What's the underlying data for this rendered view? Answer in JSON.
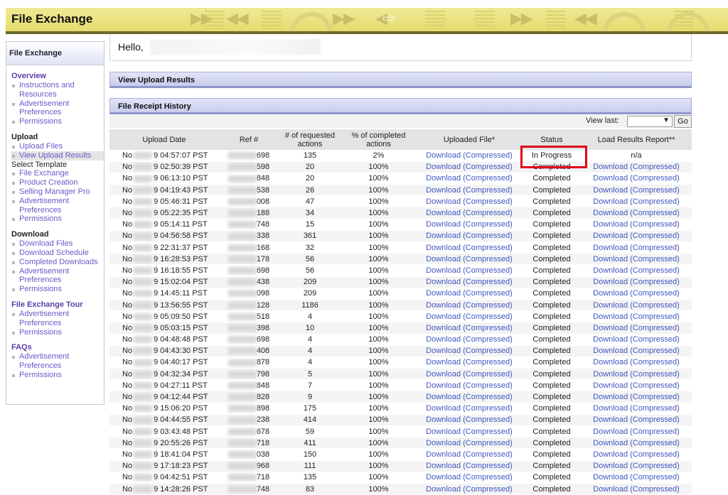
{
  "app": {
    "title": "File Exchange"
  },
  "greeting": "Hello,",
  "sidebar": {
    "title": "File Exchange",
    "sections": [
      {
        "heading": "Overview",
        "heading_is_link": true,
        "items": [
          {
            "label": "Instructions and",
            "label2": "Resources"
          },
          {
            "label": "Advertisement",
            "label2": "Preferences"
          },
          {
            "label": "Permissions"
          }
        ]
      },
      {
        "heading": "Upload",
        "heading_is_link": false,
        "items": [
          {
            "label": "Upload Files"
          },
          {
            "label": "View Upload Results",
            "active": true
          },
          {
            "plain": "Select Template"
          },
          {
            "label": "File Exchange"
          },
          {
            "label": "Product Creation"
          },
          {
            "label": "Selling Manager Pro"
          },
          {
            "label": "Advertisement",
            "label2": "Preferences"
          },
          {
            "label": "Permissions"
          }
        ]
      },
      {
        "heading": "Download",
        "heading_is_link": false,
        "items": [
          {
            "label": "Download Files"
          },
          {
            "label": "Download Schedule"
          },
          {
            "label": "Completed Downloads"
          },
          {
            "label": "Advertisement",
            "label2": "Preferences"
          },
          {
            "label": "Permissions"
          }
        ]
      },
      {
        "heading": "File Exchange Tour",
        "heading_is_link": true,
        "items": [
          {
            "label": "Advertisement",
            "label2": "Preferences"
          },
          {
            "label": "Permissions"
          }
        ]
      },
      {
        "heading": "FAQs",
        "heading_is_link": true,
        "items": [
          {
            "label": "Advertisement",
            "label2": "Preferences"
          },
          {
            "label": "Permissions"
          }
        ]
      }
    ]
  },
  "upload_results": {
    "title": "View Upload Results"
  },
  "history": {
    "title": "File Receipt History",
    "view_last_label": "View last:",
    "view_last_value": "",
    "go_label": "Go",
    "columns": [
      "Upload Date",
      "Ref #",
      "# of requested actions",
      "% of completed actions",
      "Uploaded File*",
      "Status",
      "Load Results Report**"
    ],
    "download_label": "Download",
    "compressed_label": "(Compressed)",
    "rows": [
      {
        "date": "9 04:57:07 PST",
        "ref": "698",
        "requested": "135",
        "completed": "2%",
        "status": "In Progress",
        "report": "n/a"
      },
      {
        "date": "9 02:50:39 PST",
        "ref": "598",
        "requested": "20",
        "completed": "100%",
        "status": "Completed"
      },
      {
        "date": "9 06:13:10 PST",
        "ref": "848",
        "requested": "20",
        "completed": "100%",
        "status": "Completed"
      },
      {
        "date": "9 04:19:43 PST",
        "ref": "538",
        "requested": "26",
        "completed": "100%",
        "status": "Completed"
      },
      {
        "date": "9 05:46:31 PST",
        "ref": "008",
        "requested": "47",
        "completed": "100%",
        "status": "Completed"
      },
      {
        "date": "9 05:22:35 PST",
        "ref": "188",
        "requested": "34",
        "completed": "100%",
        "status": "Completed"
      },
      {
        "date": "9 05:14:11 PST",
        "ref": "748",
        "requested": "15",
        "completed": "100%",
        "status": "Completed"
      },
      {
        "date": "9 04:56:58 PST",
        "ref": "338",
        "requested": "361",
        "completed": "100%",
        "status": "Completed"
      },
      {
        "date": "9 22:31:37 PST",
        "ref": "168",
        "requested": "32",
        "completed": "100%",
        "status": "Completed"
      },
      {
        "date": "9 16:28:53 PST",
        "ref": "178",
        "requested": "56",
        "completed": "100%",
        "status": "Completed"
      },
      {
        "date": "9 16:18:55 PST",
        "ref": "698",
        "requested": "56",
        "completed": "100%",
        "status": "Completed"
      },
      {
        "date": "9 15:02:04 PST",
        "ref": "438",
        "requested": "209",
        "completed": "100%",
        "status": "Completed"
      },
      {
        "date": "9 14:45:11 PST",
        "ref": "098",
        "requested": "209",
        "completed": "100%",
        "status": "Completed"
      },
      {
        "date": "9 13:56:55 PST",
        "ref": "128",
        "requested": "1186",
        "completed": "100%",
        "status": "Completed"
      },
      {
        "date": "9 05:09:50 PST",
        "ref": "518",
        "requested": "4",
        "completed": "100%",
        "status": "Completed"
      },
      {
        "date": "9 05:03:15 PST",
        "ref": "398",
        "requested": "10",
        "completed": "100%",
        "status": "Completed"
      },
      {
        "date": "9 04:48:48 PST",
        "ref": "698",
        "requested": "4",
        "completed": "100%",
        "status": "Completed"
      },
      {
        "date": "9 04:43:30 PST",
        "ref": "408",
        "requested": "4",
        "completed": "100%",
        "status": "Completed"
      },
      {
        "date": "9 04:40:17 PST",
        "ref": "878",
        "requested": "4",
        "completed": "100%",
        "status": "Completed"
      },
      {
        "date": "9 04:32:34 PST",
        "ref": "798",
        "requested": "5",
        "completed": "100%",
        "status": "Completed"
      },
      {
        "date": "9 04:27:11 PST",
        "ref": "848",
        "requested": "7",
        "completed": "100%",
        "status": "Completed"
      },
      {
        "date": "9 04:12:44 PST",
        "ref": "828",
        "requested": "9",
        "completed": "100%",
        "status": "Completed"
      },
      {
        "date": "9 15:06:20 PST",
        "ref": "898",
        "requested": "175",
        "completed": "100%",
        "status": "Completed"
      },
      {
        "date": "9 04:44:55 PST",
        "ref": "238",
        "requested": "414",
        "completed": "100%",
        "status": "Completed"
      },
      {
        "date": "9 03:43:48 PST",
        "ref": "678",
        "requested": "59",
        "completed": "100%",
        "status": "Completed"
      },
      {
        "date": "9 20:55:26 PST",
        "ref": "718",
        "requested": "411",
        "completed": "100%",
        "status": "Completed"
      },
      {
        "date": "9 18:41:04 PST",
        "ref": "038",
        "requested": "150",
        "completed": "100%",
        "status": "Completed"
      },
      {
        "date": "9 17:18:23 PST",
        "ref": "968",
        "requested": "111",
        "completed": "100%",
        "status": "Completed"
      },
      {
        "date": "9 04:42:51 PST",
        "ref": "718",
        "requested": "135",
        "completed": "100%",
        "status": "Completed"
      },
      {
        "date": "9 14:28:26 PST",
        "ref": "748",
        "requested": "83",
        "completed": "100%",
        "status": "Completed"
      }
    ]
  },
  "colors": {
    "header_bg": "#e5dc6e",
    "link": "#4157c2",
    "highlight": "#e0001a",
    "bar_bg": "#c8cdee"
  }
}
